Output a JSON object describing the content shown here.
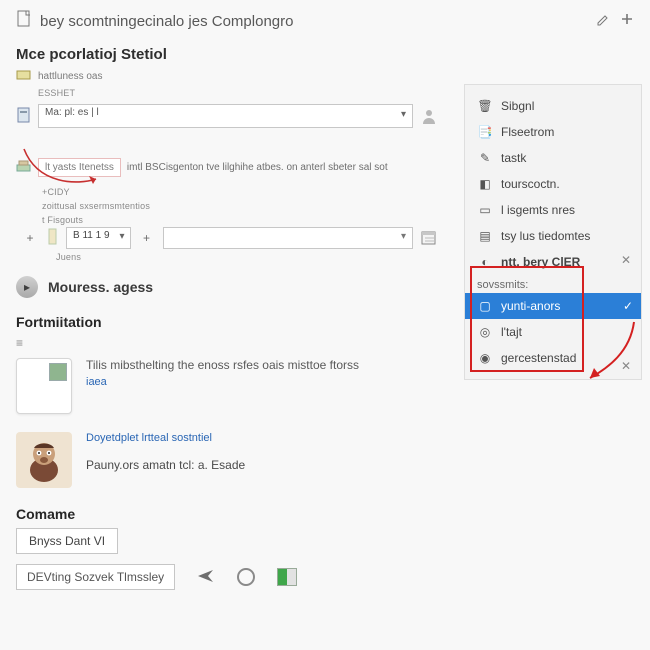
{
  "topbar": {
    "doc_icon": "doc",
    "title": "bey scomtningecinalo jes Complongro"
  },
  "section1": {
    "title": "Mce pcorlatioj Stetiol",
    "line1": "hattluness oas",
    "line2": "ESSHET",
    "combo1_value": "Ma: pl: es  | l",
    "hint_box": "lt yasts Itenetss",
    "hint_rest": "imtl BSCisgenton tve lilghihe atbes. on anterl sbeter sal sot",
    "sub_lbl1": "+CIDY",
    "sub_lbl2": "zoittusal sxsermsmtentios",
    "sub_lbl3": "t Fisgouts",
    "date_value": "B 11 1 9",
    "plus": "+",
    "tiny_under": "Juens",
    "mou_title": "Mouress. agess"
  },
  "section2": {
    "title": "Fortmiitation",
    "card1_text": "Tilis mibsthelting the enoss rsfes oais misttoe ftorss",
    "card1_link": "iaea",
    "card2_link": "Doyetdplet lrtteal sostntiel",
    "card2_text": "Pauny.ors amatn tcl: a.  Esade"
  },
  "section3": {
    "title": "Comame",
    "btn1": "Bnyss Dant VI",
    "btn2": "DEVting Sozvek Tlmssley"
  },
  "panel": {
    "items": [
      {
        "icon": "🗑",
        "label": "Sibgnl"
      },
      {
        "icon": "📑",
        "label": "Flseetrom"
      },
      {
        "icon": "✎",
        "label": "tastk"
      },
      {
        "icon": "◧",
        "label": "tourscoctn."
      },
      {
        "icon": "▭",
        "label": "l isgemts nres"
      },
      {
        "icon": "▤",
        "label": "tsy lus tiedomtes"
      },
      {
        "icon": "◐",
        "label": "ntt. bery ClER"
      }
    ],
    "sub_header": "sovssmits:",
    "sub_items": [
      {
        "icon": "▢",
        "label": "yunti-anors",
        "selected": true
      },
      {
        "icon": "◎",
        "label": "l'tajt"
      },
      {
        "icon": "◉",
        "label": "gercestenstad"
      }
    ]
  }
}
